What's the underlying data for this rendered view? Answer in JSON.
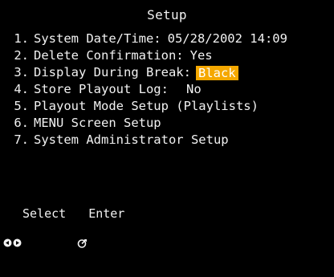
{
  "screen": {
    "title": "Setup"
  },
  "menu": {
    "items": [
      {
        "num": "1.",
        "label": "System Date/Time:",
        "value": "05/28/2002 14:09"
      },
      {
        "num": "2.",
        "label": "Delete Confirmation:",
        "value": "Yes"
      },
      {
        "num": "3.",
        "label": "Display During Break:",
        "value": "Black"
      },
      {
        "num": "4.",
        "label": "Store Playout Log:",
        "value": "No"
      },
      {
        "num": "5.",
        "label": "Playout Mode Setup (Playlists)",
        "value": ""
      },
      {
        "num": "6.",
        "label": "MENU Screen Setup",
        "value": ""
      },
      {
        "num": "7.",
        "label": "System Administrator Setup",
        "value": ""
      }
    ],
    "selected_index": 2
  },
  "footer": {
    "select_label": "Select",
    "enter_label": "Enter",
    "icons": [
      "left-arrow-icon",
      "right-arrow-icon",
      "enter-icon"
    ]
  },
  "colors": {
    "background": "#000000",
    "text": "#f2f2f2",
    "highlight": "#f5a800"
  }
}
